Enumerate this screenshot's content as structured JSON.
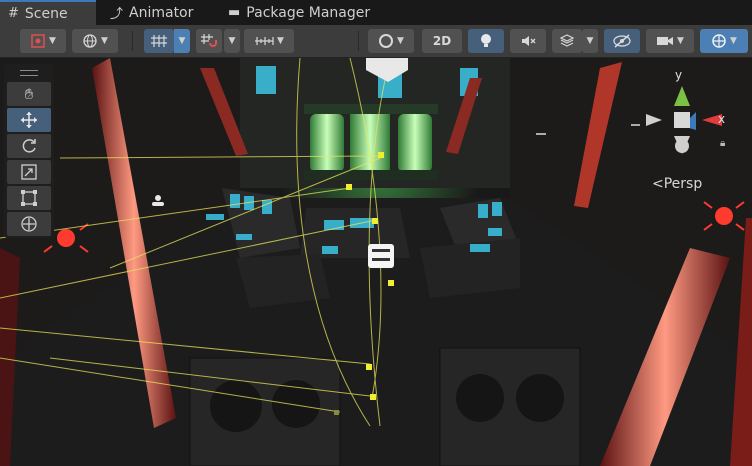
{
  "tabs": [
    {
      "label": "Scene",
      "icon": "grid-icon",
      "active": true
    },
    {
      "label": "Animator",
      "icon": "animator-icon",
      "active": false
    },
    {
      "label": "Package Manager",
      "icon": "package-icon",
      "active": false
    }
  ],
  "toolbar": {
    "toggle_2d_label": "2D",
    "items": [
      "draw-mode-icon",
      "pivot-icon",
      "grid-snap-icon",
      "snap-increment-icon",
      "ruler-icon",
      "orbit-icon",
      "2d-toggle",
      "lighting-icon",
      "audio-mute-icon",
      "effects-icon",
      "visibility-icon",
      "camera-icon",
      "gizmos-icon"
    ]
  },
  "tools": [
    "hand-icon",
    "move-icon",
    "rotate-icon",
    "scale-icon",
    "rect-icon",
    "transform-icon"
  ],
  "selected_tool": "move-icon",
  "gizmo": {
    "y_label": "y",
    "x_label": "x",
    "projection_label": "Persp"
  },
  "colors": {
    "accent": "#3a79bb",
    "active_button": "#46607c",
    "gizmo_x": "#e03c3c",
    "gizmo_y": "#7bc043",
    "gizmo_z": "#3a79bb",
    "light_red": "#ff3b30",
    "light_green": "#5cff6a"
  }
}
